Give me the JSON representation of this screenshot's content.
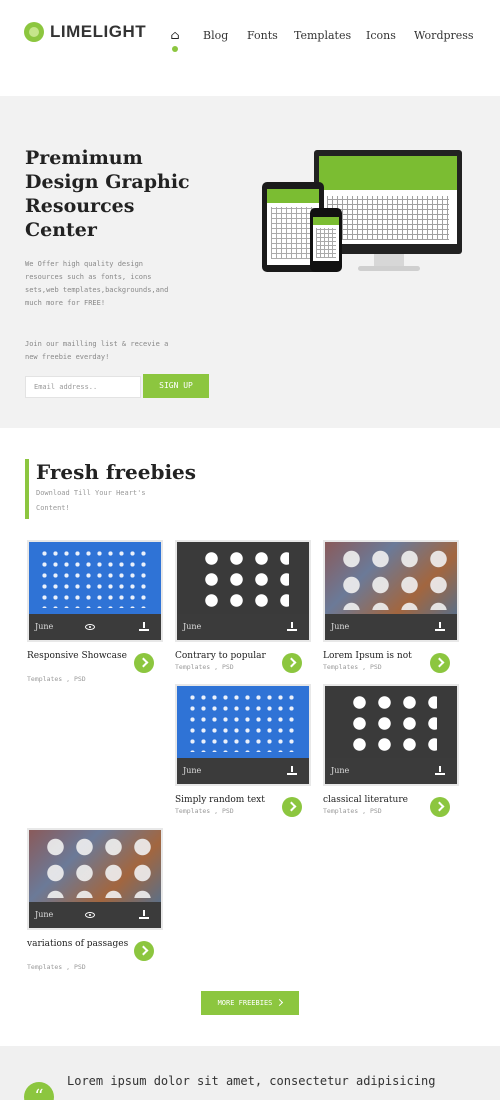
{
  "header": {
    "logo": "LIMELIGHT",
    "nav": {
      "home_icon": "home-icon",
      "items": [
        "Blog",
        "Fonts",
        "Templates",
        "Icons",
        "Wordpress"
      ]
    }
  },
  "hero": {
    "title": "Premimum Design Graphic Resources Center",
    "description": "We Offer high quality design resources such as fonts, icons sets,web templates,backgrounds,and much more for FREE!",
    "join_text": "Join our mailling list & recevie a new freebie everday!",
    "email_placeholder": "Email address..",
    "signup_label": "SIGN UP"
  },
  "freebies": {
    "title": "Fresh freebies",
    "subtitle": "Download Till Your Heart's Content!",
    "cards": [
      {
        "title": "Responsive Showcase",
        "meta": "Templates , PSD",
        "month": "June",
        "style": "blue"
      },
      {
        "title": "Contrary to popular",
        "meta": "Templates , PSD",
        "month": "June",
        "style": "dark"
      },
      {
        "title": "Lorem Ipsum is not",
        "meta": "Templates , PSD",
        "month": "June",
        "style": "bokeh"
      },
      {
        "title": "Simply random text",
        "meta": "Templates , PSD",
        "month": "June",
        "style": "blue"
      },
      {
        "title": "classical literature",
        "meta": "Templates , PSD",
        "month": "June",
        "style": "dark"
      },
      {
        "title": "variations of passages",
        "meta": "Templates , PSD",
        "month": "June",
        "style": "bokeh"
      }
    ],
    "more_label": "MORE FREEBIES"
  },
  "testimonial": {
    "quote_icon": "quote-icon",
    "text": "Lorem ipsum dolor sit amet, consectetur adipisicing"
  },
  "colors": {
    "accent": "#8cc63f",
    "card_blue": "#2f73d6",
    "card_dark": "#3a3a3a"
  }
}
